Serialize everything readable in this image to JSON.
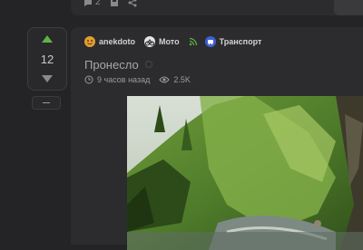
{
  "top_bar": {
    "comments_count": "2"
  },
  "vote": {
    "count": "12"
  },
  "post": {
    "tags": [
      {
        "label": "anekdoto",
        "icon": "anekdoto-community-icon"
      },
      {
        "label": "Мото",
        "icon": "moto-community-icon"
      },
      {
        "label": "Транспорт",
        "icon": "transport-community-icon"
      }
    ],
    "title": "Пронесло",
    "time_ago": "9 часов назад",
    "views": "2.5K"
  },
  "colors": {
    "upvote": "#5fb346",
    "rss": "#5fb346",
    "transport": "#3d5fd6",
    "background": "#242426"
  }
}
